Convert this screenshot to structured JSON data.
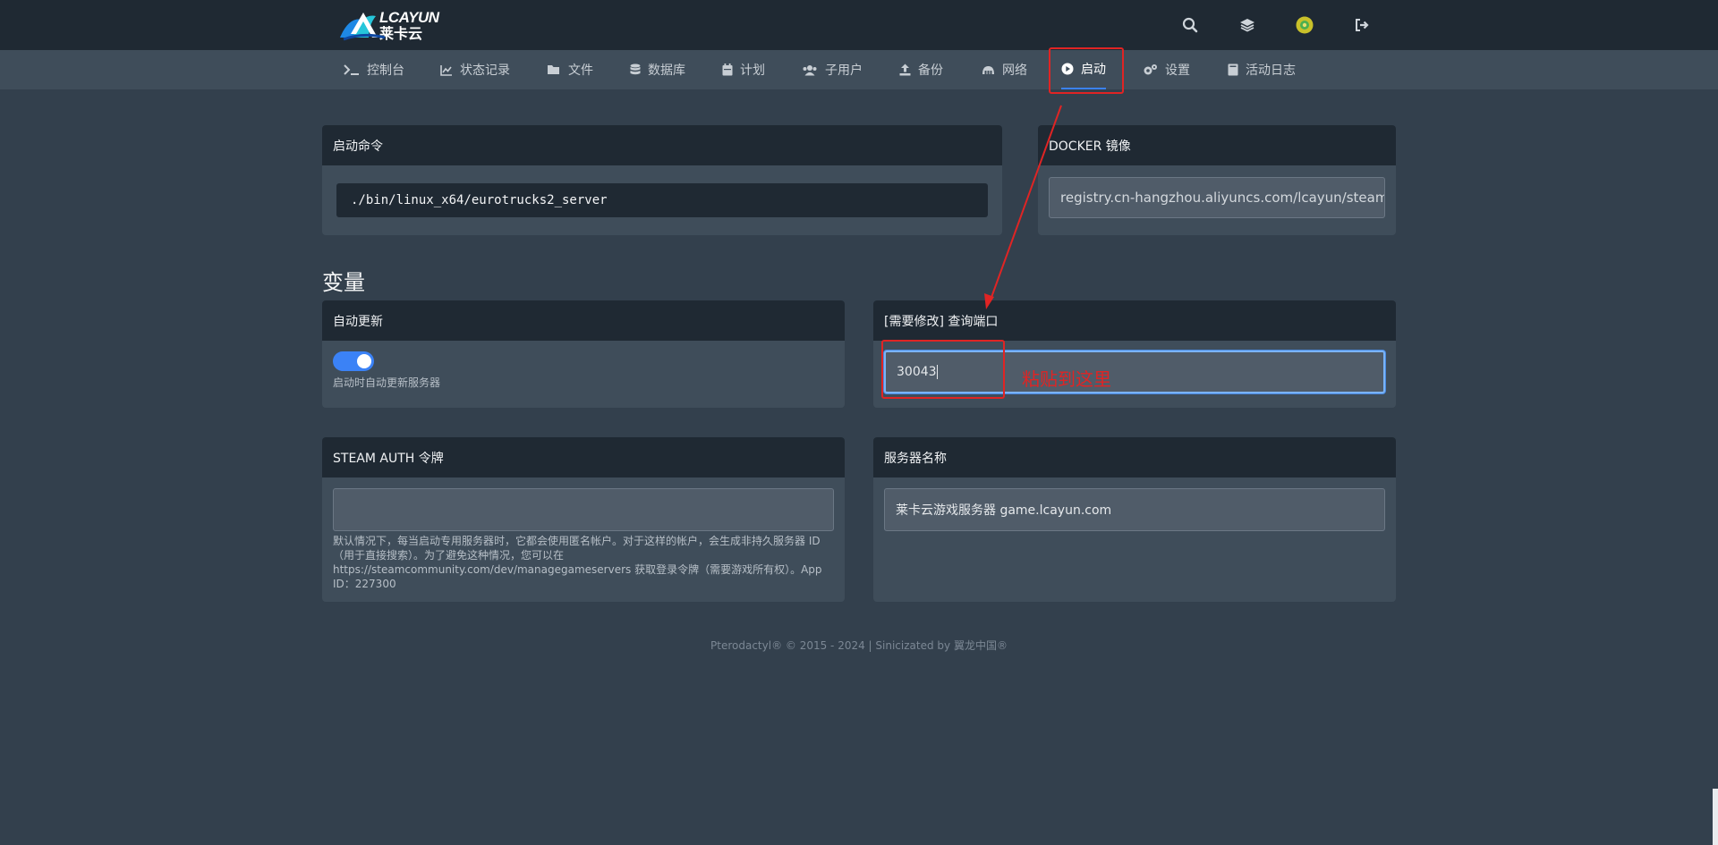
{
  "brand": {
    "name_en": "LCAYUN",
    "name_cn": "莱卡云",
    "colors": {
      "blue": "#1e88e5",
      "teal": "#26c6da",
      "dark": "#0d47a1"
    }
  },
  "header": {
    "icons": [
      "search-icon",
      "layers-icon",
      "avatar-icon",
      "logout-icon"
    ]
  },
  "nav": {
    "items": [
      {
        "label": "控制台",
        "icon": "terminal-icon"
      },
      {
        "label": "状态记录",
        "icon": "chart-icon"
      },
      {
        "label": "文件",
        "icon": "folder-icon"
      },
      {
        "label": "数据库",
        "icon": "database-icon"
      },
      {
        "label": "计划",
        "icon": "calendar-icon"
      },
      {
        "label": "子用户",
        "icon": "users-icon"
      },
      {
        "label": "备份",
        "icon": "upload-icon"
      },
      {
        "label": "网络",
        "icon": "network-icon"
      },
      {
        "label": "启动",
        "icon": "play-icon",
        "active": true
      },
      {
        "label": "设置",
        "icon": "gears-icon"
      },
      {
        "label": "活动日志",
        "icon": "book-icon"
      }
    ]
  },
  "startup": {
    "title": "启动命令",
    "command": "./bin/linux_x64/eurotrucks2_server"
  },
  "docker": {
    "title": "DOCKER 镜像",
    "value": "registry.cn-hangzhou.aliyuncs.com/lcayun/steamcm"
  },
  "variables": {
    "title": "变量",
    "auto_update": {
      "title": "自动更新",
      "enabled": true,
      "description": "启动时自动更新服务器"
    },
    "query_port": {
      "title": "[需要修改] 查询端口",
      "value": "30043"
    },
    "steam_auth": {
      "title": "STEAM AUTH 令牌",
      "value": "",
      "description_lines": [
        "默认情况下，每当启动专用服务器时，它都会使用匿名帐户。对于这样的帐户，会生成非持久服务器 ID",
        "（用于直接搜索）。为了避免这种情况，您可以在",
        "https://steamcommunity.com/dev/managegameservers 获取登录令牌（需要游戏所有权）。App",
        "ID：227300"
      ]
    },
    "server_name": {
      "title": "服务器名称",
      "value": "莱卡云游戏服务器 game.lcayun.com"
    }
  },
  "annotation": {
    "text": "粘贴到这里",
    "color": "#e02424"
  },
  "footer": {
    "text": "Pterodactyl® © 2015 - 2024 | Sinicizated by 翼龙中国®"
  }
}
